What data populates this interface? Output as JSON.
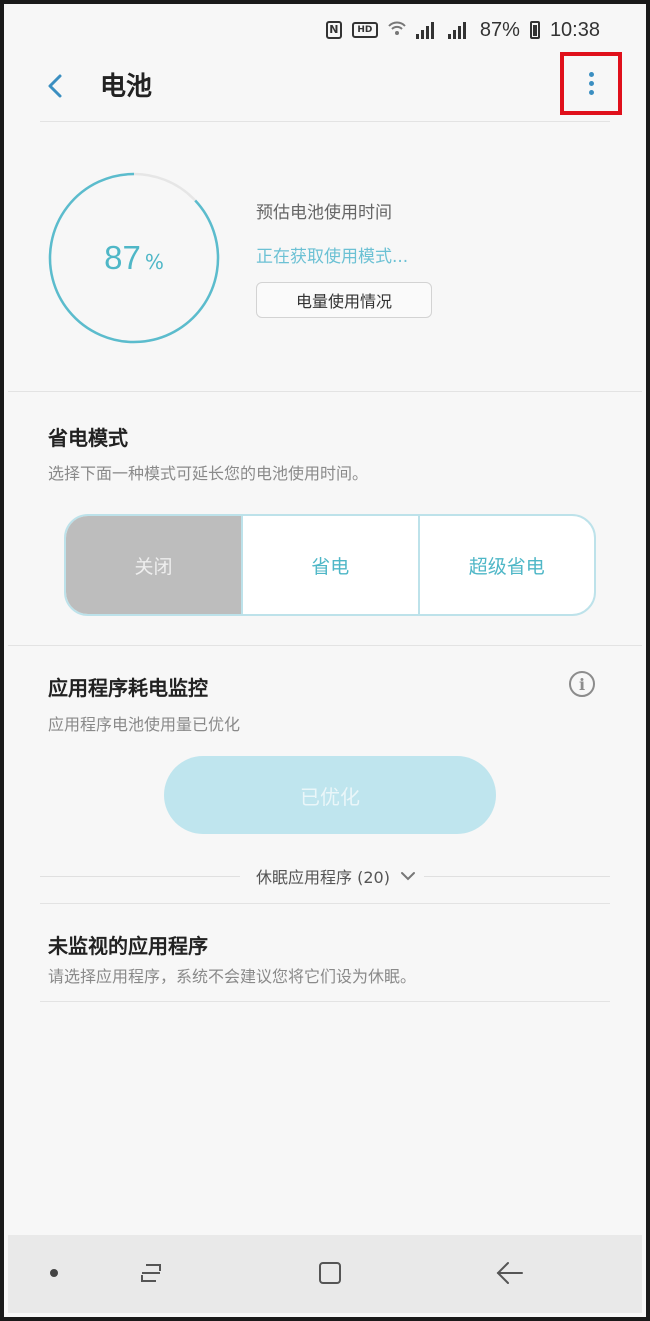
{
  "status_bar": {
    "nfc": "N",
    "hd": "HD",
    "battery_text": "87%",
    "time": "10:38"
  },
  "header": {
    "title": "电池",
    "back_icon": "chevron-left-icon",
    "more_icon": "more-vertical-icon",
    "highlight_color": "#e0101b"
  },
  "battery": {
    "percent": "87",
    "percent_sign": "%",
    "level_fraction": 0.87,
    "estimate_label": "预估电池使用时间",
    "estimate_status": "正在获取使用模式...",
    "usage_button": "电量使用情况",
    "accent_color": "#4fb7c7"
  },
  "power_saving": {
    "title": "省电模式",
    "description": "选择下面一种模式可延长您的电池使用时间。",
    "modes": [
      "关闭",
      "省电",
      "超级省电"
    ],
    "selected_mode": "关闭"
  },
  "app_monitor": {
    "title": "应用程序耗电监控",
    "description": "应用程序电池使用量已优化",
    "optimized_button": "已优化",
    "info_icon": "info-icon",
    "sleeping_apps_label": "休眠应用程序 (20)"
  },
  "unmonitored": {
    "title": "未监视的应用程序",
    "description": "请选择应用程序，系统不会建议您将它们设为休眠。"
  },
  "nav_bar": {
    "items": [
      "dot-icon",
      "recent-apps-icon",
      "home-icon",
      "back-icon"
    ]
  }
}
